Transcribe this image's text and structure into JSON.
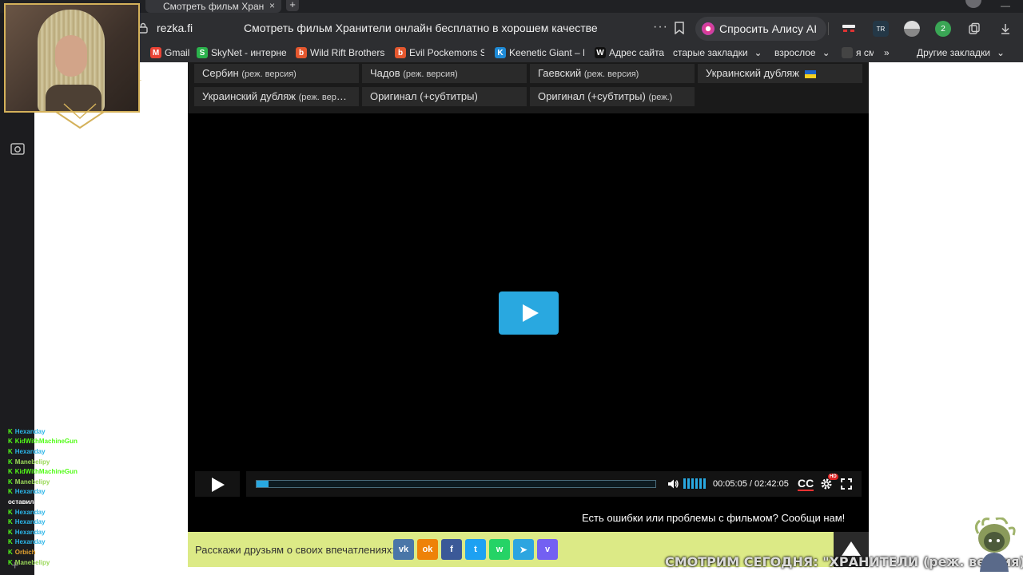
{
  "browser": {
    "tab_title": "Смотреть фильм Хран",
    "new_tab": "+",
    "tab_close": "×",
    "domain": "rezka.fi",
    "page_title": "Смотреть фильм Хранители онлайн бесплатно в хорошем качестве",
    "more": "···",
    "alice_label": "Спросить Алису AI",
    "ext_badge": "2",
    "ext_tr": "TR"
  },
  "bookmarks": [
    {
      "label": "Gmail",
      "icon": "gmail-icon",
      "color": "#ea4335",
      "glyph": "M"
    },
    {
      "label": "SkyNet - интернет",
      "icon": "skynet-icon",
      "color": "#2bb24c",
      "glyph": "S"
    },
    {
      "label": "Wild Rift Brothers",
      "icon": "wildrift-icon",
      "color": "#e4572e",
      "glyph": "b"
    },
    {
      "label": "Evil Pockemons Se",
      "icon": "evil-icon",
      "color": "#e4572e",
      "glyph": "b"
    },
    {
      "label": "Keenetic Giant – П",
      "icon": "keenetic-icon",
      "color": "#1e8ad6",
      "glyph": "K"
    },
    {
      "label": "Адрес сайта",
      "icon": "w-icon",
      "color": "#111111",
      "glyph": "W"
    },
    {
      "label": "старые закладки",
      "icon": "folder-icon",
      "color": "",
      "glyph": ""
    },
    {
      "label": "взрослое",
      "icon": "folder-icon",
      "color": "",
      "glyph": ""
    },
    {
      "label": "я см",
      "icon": "tv-icon",
      "color": "#444444",
      "glyph": ""
    }
  ],
  "bookmarks_more": "»",
  "bookmarks_other": "Другие закладки",
  "translators": [
    {
      "name": "Сербин",
      "note": "(реж. версия)"
    },
    {
      "name": "Чадов",
      "note": "(реж. версия)"
    },
    {
      "name": "Гаевский",
      "note": "(реж. версия)"
    },
    {
      "name": "Украинский дубляж",
      "note": ""
    },
    {
      "name": "Украинский дубляж",
      "note": "(реж. версия)"
    },
    {
      "name": "Оригинал (+субтитры)",
      "note": ""
    },
    {
      "name": "Оригинал (+субтитры)",
      "note": "(реж.)"
    }
  ],
  "player": {
    "current_time": "00:05:05",
    "duration": "02:42:05",
    "time_sep": " / ",
    "progress_fraction": 0.031,
    "cc_label": "CC",
    "hd_badge": "HD",
    "report_text": "Есть ошибки или проблемы с фильмом? Сообщи нам!"
  },
  "share": {
    "label": "Расскажи друзьям о своих впечатлениях:",
    "networks": [
      {
        "name": "vk",
        "color": "#4a76a8",
        "glyph": "vk"
      },
      {
        "name": "ok",
        "color": "#ee8208",
        "glyph": "ok"
      },
      {
        "name": "facebook",
        "color": "#3b5998",
        "glyph": "f"
      },
      {
        "name": "twitter",
        "color": "#1da1f2",
        "glyph": "t"
      },
      {
        "name": "whatsapp",
        "color": "#25d366",
        "glyph": "w"
      },
      {
        "name": "telegram",
        "color": "#2ca5e0",
        "glyph": "➤"
      },
      {
        "name": "viber",
        "color": "#7360f2",
        "glyph": "v"
      }
    ]
  },
  "chat": [
    {
      "user": "Hexanday",
      "color": "#2bb5e8",
      "msg": ""
    },
    {
      "user": "KidWithMachineGun",
      "color": "#53fc18",
      "msg": "..."
    },
    {
      "user": "Hexanday",
      "color": "#2bb5e8",
      "msg": "..."
    },
    {
      "user": "Manebelipy",
      "color": "#9bd85a",
      "msg": "..."
    },
    {
      "user": "KidWithMachineGun",
      "color": "#53fc18",
      "msg": "..."
    },
    {
      "user": "Manebelipy",
      "color": "#9bd85a",
      "msg": "..."
    },
    {
      "user": "Hexanday",
      "color": "#2bb5e8",
      "msg": "..."
    },
    {
      "user": "оставила",
      "color": "#ffffff",
      "msg": ""
    },
    {
      "user": "Hexanday",
      "color": "#2bb5e8",
      "msg": ""
    },
    {
      "user": "Hexanday",
      "color": "#2bb5e8",
      "msg": "..."
    },
    {
      "user": "Hexanday",
      "color": "#2bb5e8",
      "msg": "..."
    },
    {
      "user": "Hexanday",
      "color": "#2bb5e8",
      "msg": ""
    },
    {
      "user": "Orbich",
      "color": "#e8a531",
      "msg": "..."
    },
    {
      "user": "Manebelipy",
      "color": "#9bd85a",
      "msg": ""
    }
  ],
  "ticker": "СМОТРИМ СЕГОДНЯ: \"ХРАНИТЕЛИ (реж. версия)\"",
  "accent": "#29a8e0"
}
